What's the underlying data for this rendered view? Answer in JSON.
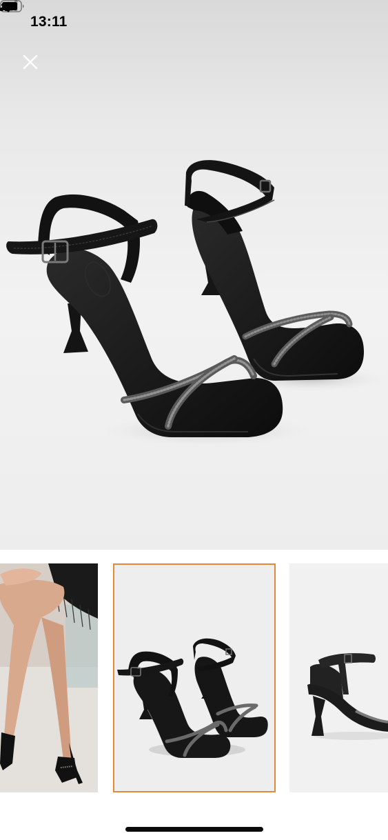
{
  "status_bar": {
    "time": "13:11",
    "signal_icon": "cellular-signal-icon",
    "wifi_icon": "wifi-icon",
    "battery_icon": "battery-icon"
  },
  "viewer": {
    "close_icon": "close-icon",
    "main_image": "black-heeled-sandals-with-rhinestone-cross-straps",
    "thumbnails": [
      {
        "image": "model-legs-wearing-black-sandals",
        "selected": false
      },
      {
        "image": "black-heeled-sandals-pair",
        "selected": true
      },
      {
        "image": "black-sandal-side-view",
        "selected": false
      }
    ],
    "selected_border_color": "#e0893a"
  }
}
